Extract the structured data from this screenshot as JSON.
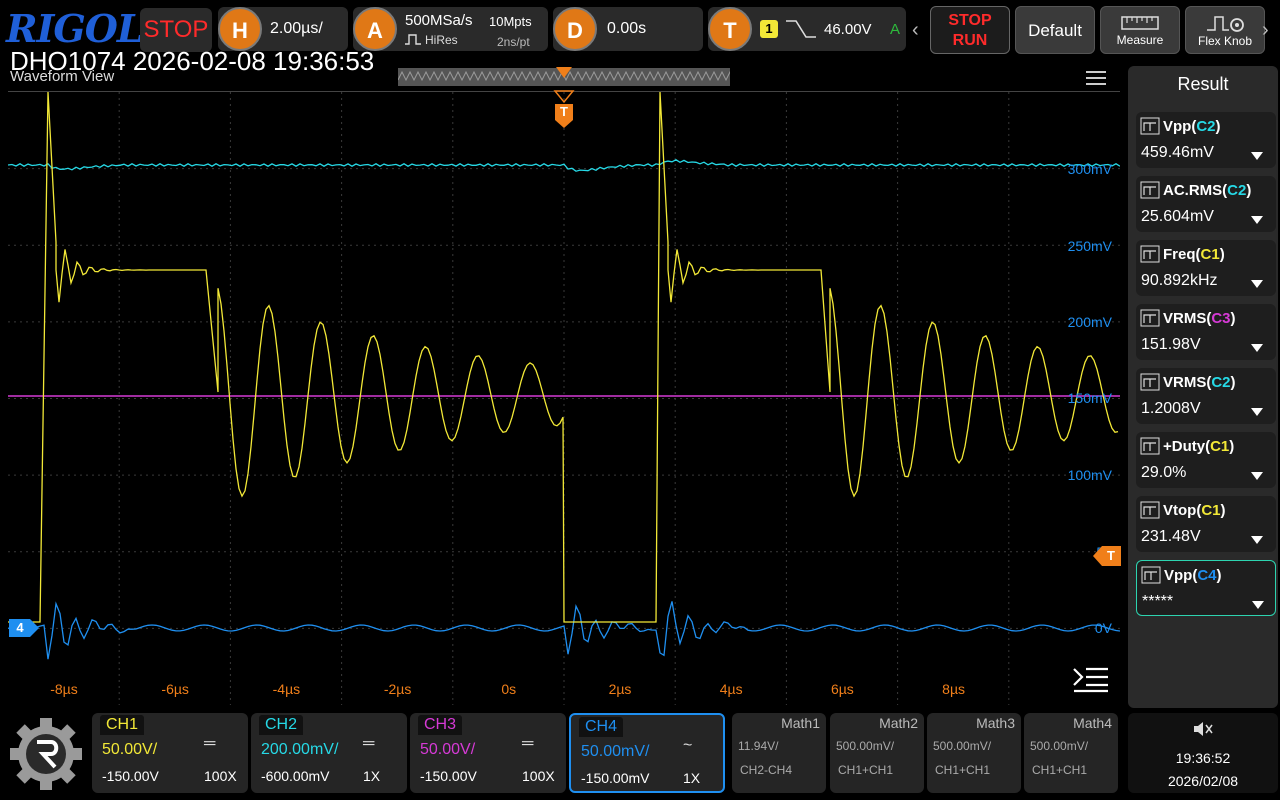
{
  "header": {
    "logo": "RIGOL",
    "run_state": "STOP",
    "horizontal": {
      "letter": "H",
      "scale": "2.00µs/"
    },
    "acquire": {
      "letter": "A",
      "rate": "500MSa/s",
      "mode": "HiRes",
      "depth": "10Mpts",
      "resolution": "2ns/pt"
    },
    "delay": {
      "letter": "D",
      "value": "0.00s"
    },
    "trigger": {
      "letter": "T",
      "source": "1",
      "level": "46.00V",
      "mode": "A"
    },
    "buttons": {
      "stop_run_top": "STOP",
      "stop_run_bottom": "RUN",
      "default": "Default",
      "measure": "Measure",
      "flex_knob": "Flex Knob"
    }
  },
  "overlay": {
    "title": "DHO1074 2026-02-08 19:36:53",
    "view_label": "Waveform View"
  },
  "waveform": {
    "x_ticks": [
      "-8µs",
      "-6µs",
      "-4µs",
      "-2µs",
      "0s",
      "2µs",
      "4µs",
      "6µs",
      "8µs"
    ],
    "right_scale": [
      "300mV",
      "250mV",
      "200mV",
      "150mV",
      "100mV",
      "50",
      "0V"
    ],
    "trigger_marker": "T",
    "ch4_marker": "4",
    "colors": {
      "ch1": "#f2e837",
      "ch2": "#26d9e6",
      "ch3": "#d63ad6",
      "ch4": "#1f8ff0",
      "trigger": "#f07f1a"
    }
  },
  "result": {
    "title": "Result",
    "items": [
      {
        "name": "Vpp",
        "src": "C2",
        "src_color": "#26d9e6",
        "value": "459.46mV"
      },
      {
        "name": "AC.RMS",
        "src": "C2",
        "src_color": "#26d9e6",
        "value": "25.604mV"
      },
      {
        "name": "Freq",
        "src": "C1",
        "src_color": "#f2e837",
        "value": "90.892kHz"
      },
      {
        "name": "VRMS",
        "src": "C3",
        "src_color": "#d63ad6",
        "value": "151.98V"
      },
      {
        "name": "VRMS",
        "src": "C2",
        "src_color": "#26d9e6",
        "value": "1.2008V"
      },
      {
        "name": "+Duty",
        "src": "C1",
        "src_color": "#f2e837",
        "value": "29.0%"
      },
      {
        "name": "Vtop",
        "src": "C1",
        "src_color": "#f2e837",
        "value": "231.48V"
      },
      {
        "name": "Vpp",
        "src": "C4",
        "src_color": "#1f8ff0",
        "value": "*****"
      }
    ]
  },
  "channels": [
    {
      "name": "CH1",
      "scale": "50.00V/",
      "offset": "-150.00V",
      "probe": "100X",
      "coupling": "═",
      "color": "#f2e837"
    },
    {
      "name": "CH2",
      "scale": "200.00mV/",
      "offset": "-600.00mV",
      "probe": "1X",
      "coupling": "═",
      "color": "#26d9e6"
    },
    {
      "name": "CH3",
      "scale": "50.00V/",
      "offset": "-150.00V",
      "probe": "100X",
      "coupling": "═",
      "color": "#d63ad6"
    },
    {
      "name": "CH4",
      "scale": "50.00mV/",
      "offset": "-150.00mV",
      "probe": "1X",
      "coupling": "~",
      "color": "#1f8ff0"
    }
  ],
  "math": [
    {
      "name": "Math1",
      "scale": "11.94V/",
      "expr": "CH2-CH4"
    },
    {
      "name": "Math2",
      "scale": "500.00mV/",
      "expr": "CH1+CH1"
    },
    {
      "name": "Math3",
      "scale": "500.00mV/",
      "expr": "CH1+CH1"
    },
    {
      "name": "Math4",
      "scale": "500.00mV/",
      "expr": "CH1+CH1"
    }
  ],
  "clock": {
    "time": "19:36:52",
    "date": "2026/02/08"
  }
}
